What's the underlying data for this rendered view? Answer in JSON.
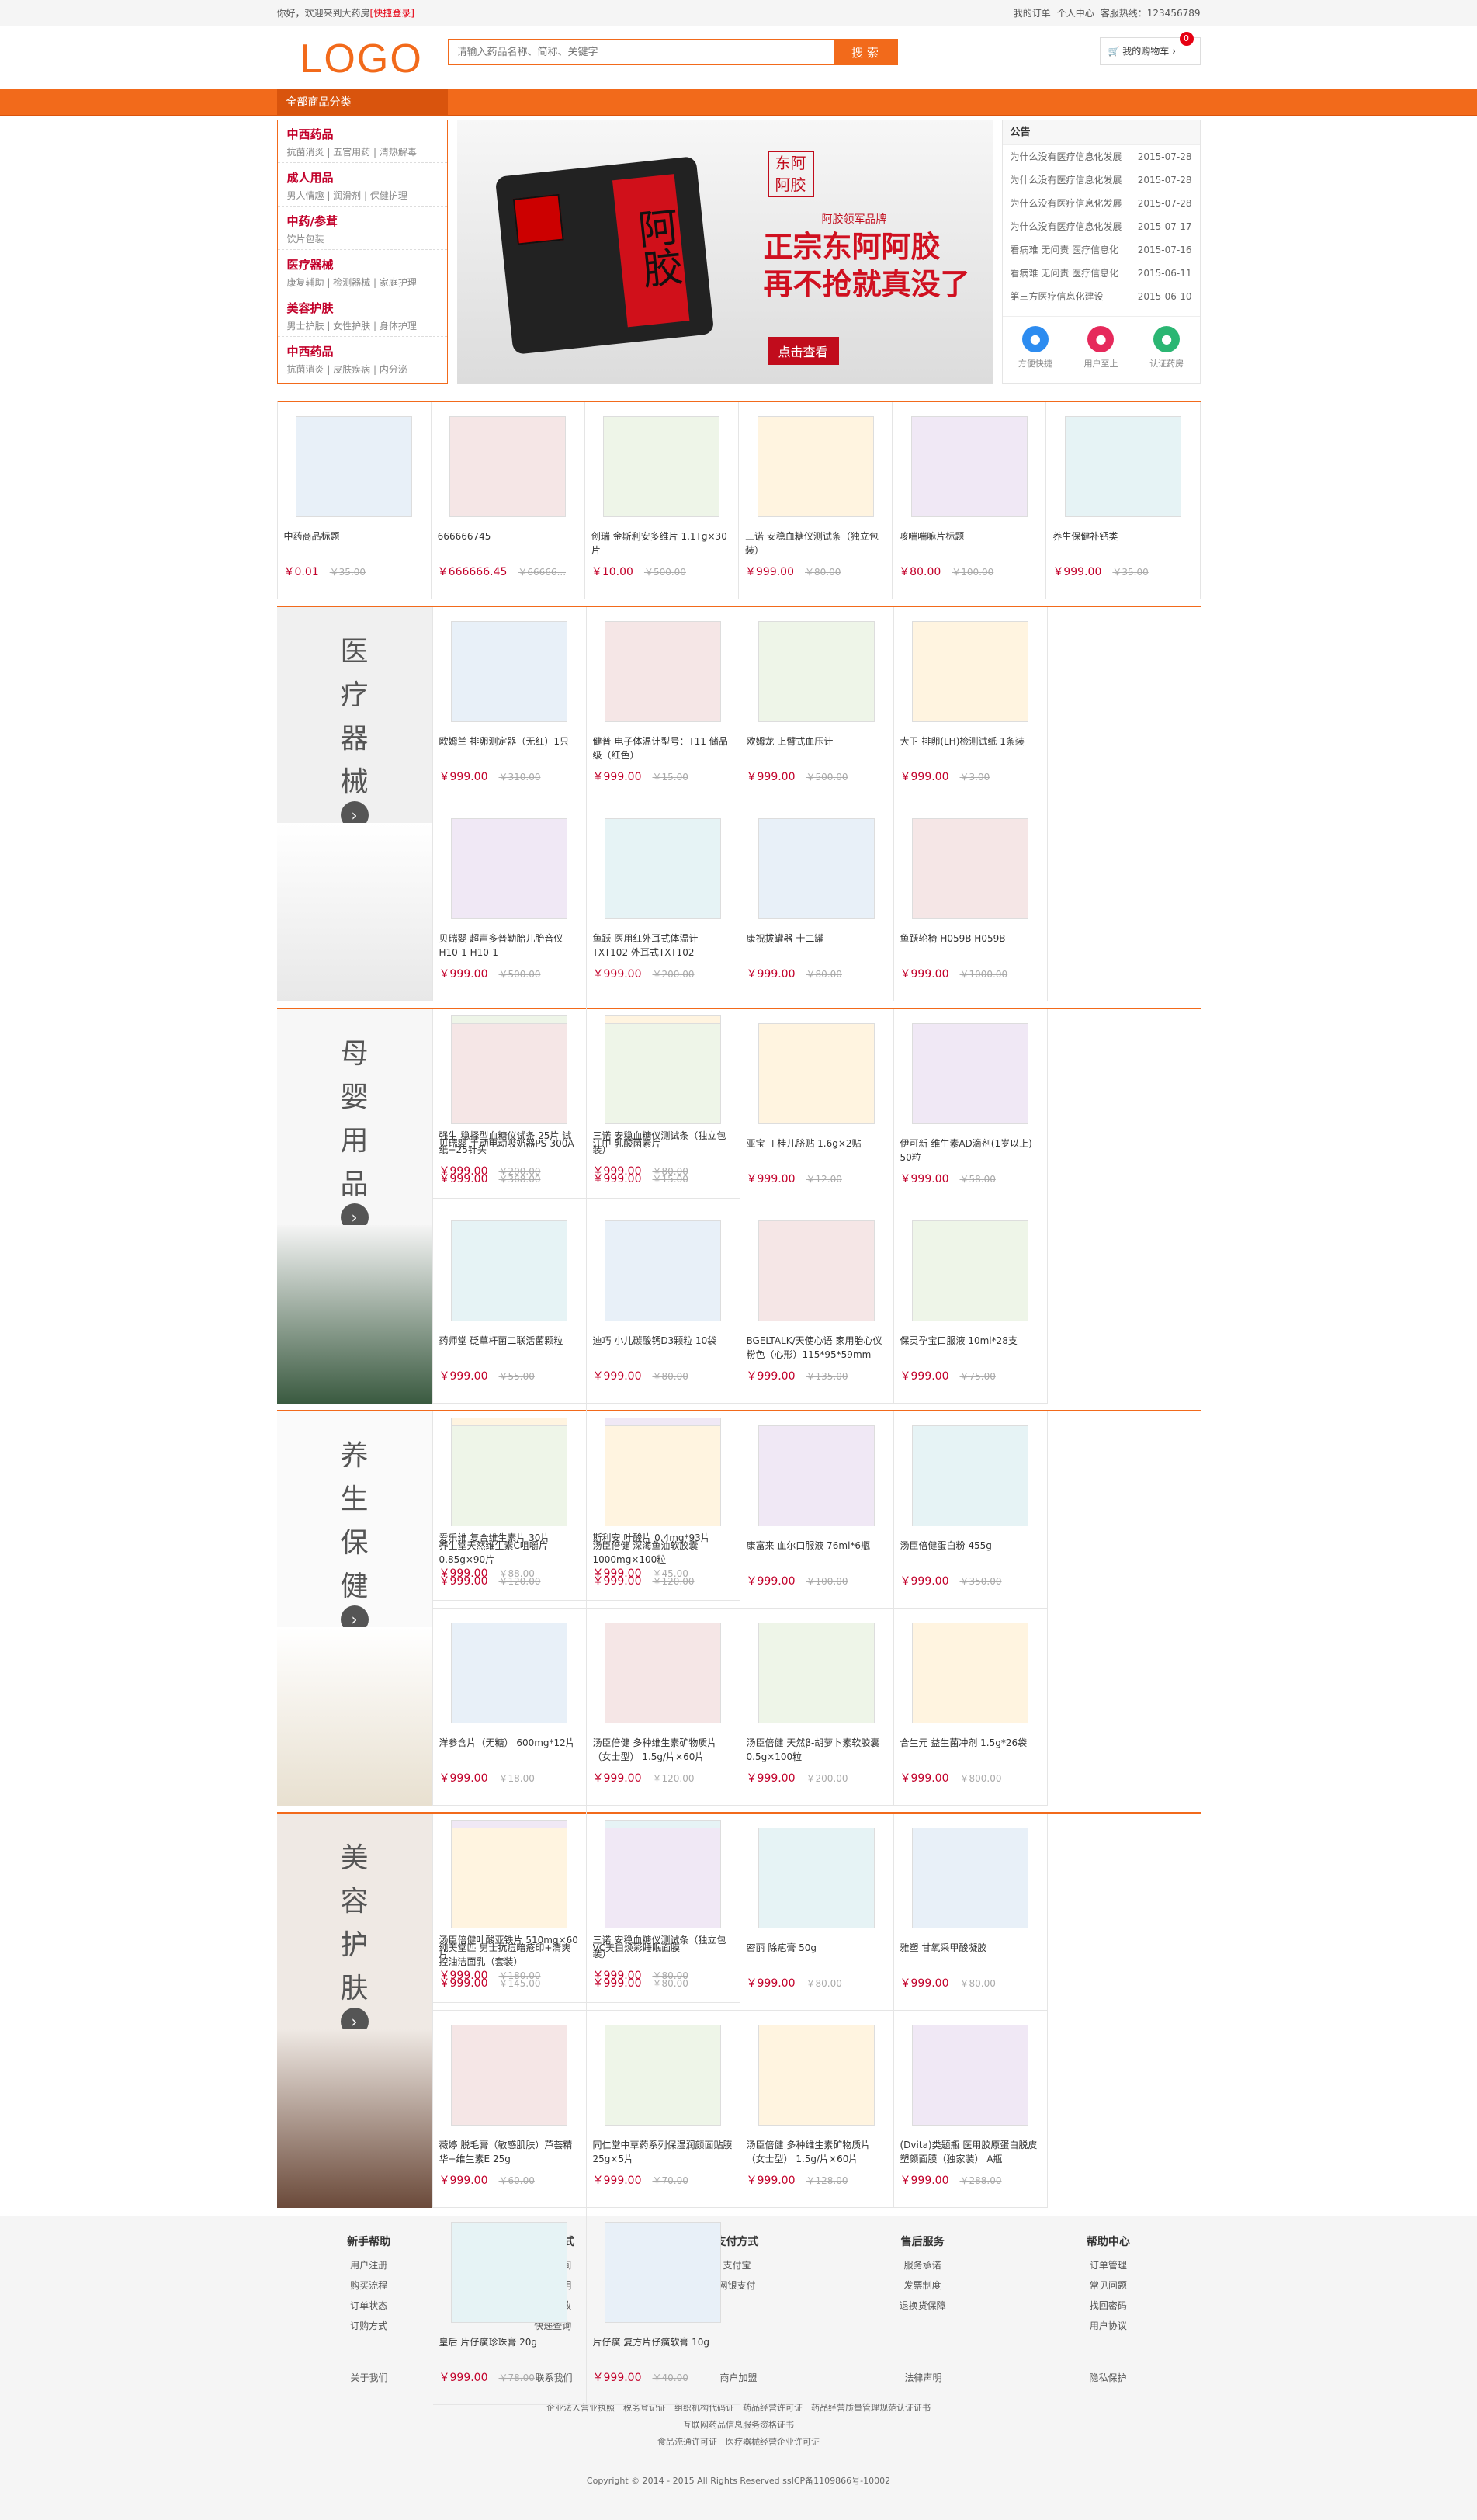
{
  "top": {
    "welcome": "你好，欢迎来到大药房",
    "login": "[快捷登录]",
    "orders": "我的订单",
    "ucenter": "个人中心",
    "hotline": "客服热线：123456789"
  },
  "header": {
    "logo": "LOGO",
    "search_placeholder": "请输入药品名称、简称、关键字",
    "search_btn": "搜 索",
    "cart": "我的购物车",
    "cart_count": "0"
  },
  "nav": {
    "allcat": "全部商品分类"
  },
  "cats": [
    {
      "t": "中西药品",
      "s": "抗菌消炎 | 五官用药 | 清热解毒"
    },
    {
      "t": "成人用品",
      "s": "男人情趣 | 润滑剂 | 保健护理"
    },
    {
      "t": "中药/参茸",
      "s": "饮片包装"
    },
    {
      "t": "医疗器械",
      "s": "康复辅助 | 检测器械 | 家庭护理"
    },
    {
      "t": "美容护肤",
      "s": "男士护肤 | 女性护肤 | 身体护理"
    },
    {
      "t": "中西药品",
      "s": "抗菌消炎 | 皮肤疾病 | 内分泌"
    }
  ],
  "slide": {
    "brand": "阿胶领军品牌",
    "h1a": "正宗东阿阿胶",
    "h1b": "再不抢就真没了",
    "btn": "点击查看",
    "box": "阿胶",
    "stamp": "东阿阿胶"
  },
  "notice": {
    "title": "公告",
    "items": [
      {
        "n": "为什么没有医疗信息化发展",
        "d": "2015-07-28"
      },
      {
        "n": "为什么没有医疗信息化发展",
        "d": "2015-07-28"
      },
      {
        "n": "为什么没有医疗信息化发展",
        "d": "2015-07-28"
      },
      {
        "n": "为什么没有医疗信息化发展",
        "d": "2015-07-17"
      },
      {
        "n": "看病难 无问责 医疗信息化",
        "d": "2015-07-16"
      },
      {
        "n": "看病难 无问责 医疗信息化",
        "d": "2015-06-11"
      },
      {
        "n": "第三方医疗信息化建设",
        "d": "2015-06-10"
      }
    ],
    "svc": [
      {
        "l": "方便快捷",
        "c": "#2d8cf0"
      },
      {
        "l": "用户至上",
        "c": "#e6295b"
      },
      {
        "l": "认证药房",
        "c": "#2bb673"
      }
    ]
  },
  "row1": [
    {
      "n": "中药商品标题",
      "p": "￥0.01",
      "o": "￥35.00"
    },
    {
      "n": "666666745",
      "p": "￥666666.45",
      "o": "￥66666..."
    },
    {
      "n": "创瑞 金斯利安多维片 1.1Tg×30片",
      "p": "￥10.00",
      "o": "￥500.00"
    },
    {
      "n": "三诺 安稳血糖仪测试条（独立包装）",
      "p": "￥999.00",
      "o": "￥80.00"
    },
    {
      "n": "咳喘喘嘛片标题",
      "p": "￥80.00",
      "o": "￥100.00"
    },
    {
      "n": "养生保健补钙类",
      "p": "￥999.00",
      "o": "￥35.00"
    }
  ],
  "floors": [
    {
      "title": [
        "医",
        "疗",
        "器",
        "械"
      ],
      "items": [
        {
          "n": "欧姆兰 排卵测定器（无红）1只",
          "p": "￥999.00",
          "o": "￥310.00"
        },
        {
          "n": "健普 电子体温计型号：T11 储品级（红色）",
          "p": "￥999.00",
          "o": "￥15.00"
        },
        {
          "n": "欧姆龙 上臂式血压计",
          "p": "￥999.00",
          "o": "￥500.00"
        },
        {
          "n": "大卫 排卵(LH)检测试纸 1条装",
          "p": "￥999.00",
          "o": "￥3.00"
        },
        {
          "n": "贝瑞婴 超声多普勒胎儿胎音仪 H10-1 H10-1",
          "p": "￥999.00",
          "o": "￥500.00"
        },
        {
          "n": "鱼跃 医用红外耳式体温计 TXT102 外耳式TXT102",
          "p": "￥999.00",
          "o": "￥200.00"
        },
        {
          "n": "康祝拔罐器 十二罐",
          "p": "￥999.00",
          "o": "￥80.00"
        },
        {
          "n": "鱼跃轮椅 H059B H059B",
          "p": "￥999.00",
          "o": "￥1000.00"
        },
        {
          "n": "强生 稳择型血糖仪试条 25片 试纸+25针头",
          "p": "￥999.00",
          "o": "￥200.00"
        },
        {
          "n": "三诺 安稳血糖仪测试条（独立包装）",
          "p": "￥999.00",
          "o": "￥80.00"
        }
      ]
    },
    {
      "title": [
        "母",
        "婴",
        "用",
        "品"
      ],
      "items": [
        {
          "n": "贝瑞婴 手动电动吸奶器PS-300A",
          "p": "￥999.00",
          "o": "￥368.00"
        },
        {
          "n": "江中 乳酸菌素片",
          "p": "￥999.00",
          "o": "￥15.00"
        },
        {
          "n": "亚宝 丁桂儿脐贴 1.6g×2贴",
          "p": "￥999.00",
          "o": "￥12.00"
        },
        {
          "n": "伊可新 维生素AD滴剂(1岁以上) 50粒",
          "p": "￥999.00",
          "o": "￥58.00"
        },
        {
          "n": "药师堂 砭草杆菌二联活菌颗粒",
          "p": "￥999.00",
          "o": "￥55.00"
        },
        {
          "n": "迪巧 小儿碳酸钙D3颗粒 10袋",
          "p": "￥999.00",
          "o": "￥80.00"
        },
        {
          "n": "BGELTALK/天使心语 家用胎心仪 粉色（心形）115*95*59mm",
          "p": "￥999.00",
          "o": "￥135.00"
        },
        {
          "n": "保灵孕宝口服液 10ml*28支",
          "p": "￥999.00",
          "o": "￥75.00"
        },
        {
          "n": "爱乐维 复合维生素片 30片",
          "p": "￥999.00",
          "o": "￥88.00"
        },
        {
          "n": "斯利安 叶酸片 0.4mg*93片",
          "p": "￥999.00",
          "o": "￥45.00"
        }
      ]
    },
    {
      "title": [
        "养",
        "生",
        "保",
        "健"
      ],
      "items": [
        {
          "n": "养生堂天然维生素C咀嚼片 0.85g×90片",
          "p": "￥999.00",
          "o": "￥120.00"
        },
        {
          "n": "汤臣倍健 深海鱼油软胶囊 1000mg×100粒",
          "p": "￥999.00",
          "o": "￥120.00"
        },
        {
          "n": "康富来 血尔口服液 76ml*6瓶",
          "p": "￥999.00",
          "o": "￥100.00"
        },
        {
          "n": "汤臣倍健蛋白粉 455g",
          "p": "￥999.00",
          "o": "￥350.00"
        },
        {
          "n": "洋参含片（无糖） 600mg*12片",
          "p": "￥999.00",
          "o": "￥18.00"
        },
        {
          "n": "汤臣倍健 多种维生素矿物质片（女士型） 1.5g/片×60片",
          "p": "￥999.00",
          "o": "￥120.00"
        },
        {
          "n": "汤臣倍健 天然β-胡萝卜素软胶囊 0.5g×100粒",
          "p": "￥999.00",
          "o": "￥200.00"
        },
        {
          "n": "合生元 益生菌冲剂 1.5g*26袋",
          "p": "￥999.00",
          "o": "￥800.00"
        },
        {
          "n": "汤臣倍健叶酸亚铁片 510mg×60片",
          "p": "￥999.00",
          "o": "￥180.00"
        },
        {
          "n": "三诺 安稳血糖仪测试条（独立包装）",
          "p": "￥999.00",
          "o": "￥80.00"
        }
      ]
    },
    {
      "title": [
        "美",
        "容",
        "护",
        "肤"
      ],
      "items": [
        {
          "n": "纯美堂匹 男士抗痘暗疮印+清爽控油洁面乳（套装）",
          "p": "￥999.00",
          "o": "￥145.00"
        },
        {
          "n": "VC美白焕彩睡眠面膜",
          "p": "￥999.00",
          "o": "￥80.00"
        },
        {
          "n": "密丽 除疤膏 50g",
          "p": "￥999.00",
          "o": "￥80.00"
        },
        {
          "n": "雅塑 甘氧采甲酸凝胶",
          "p": "￥999.00",
          "o": "￥80.00"
        },
        {
          "n": "薇婷 脱毛膏（敏感肌肤）芦荟精华+维生素E 25g",
          "p": "￥999.00",
          "o": "￥60.00"
        },
        {
          "n": "同仁堂中草药系列保湿润颜面贴膜 25g×5片",
          "p": "￥999.00",
          "o": "￥70.00"
        },
        {
          "n": "汤臣倍健 多种维生素矿物质片（女士型） 1.5g/片×60片",
          "p": "￥999.00",
          "o": "￥128.00"
        },
        {
          "n": "(Dvita)类题瓶 医用胶原蛋白脱皮塑颜面膜（独家装） A瓶",
          "p": "￥999.00",
          "o": "￥288.00"
        },
        {
          "n": "皇后 片仔癀珍珠膏 20g",
          "p": "￥999.00",
          "o": "￥78.00"
        },
        {
          "n": "片仔癀 复方片仔癀软膏 10g",
          "p": "￥999.00",
          "o": "￥40.00"
        }
      ]
    }
  ],
  "footer": {
    "cols": [
      {
        "h": "新手帮助",
        "i": [
          "用户注册",
          "购买流程",
          "订单状态",
          "订购方式"
        ]
      },
      {
        "h": "配送方式",
        "i": [
          "送货时间",
          "运费说明",
          "商品签收",
          "快递查询"
        ]
      },
      {
        "h": "支付方式",
        "i": [
          "支付宝",
          "网银支付"
        ]
      },
      {
        "h": "售后服务",
        "i": [
          "服务承诺",
          "发票制度",
          "退换货保障"
        ]
      },
      {
        "h": "帮助中心",
        "i": [
          "订单管理",
          "常见问题",
          "找回密码",
          "用户协议"
        ]
      }
    ],
    "links": [
      "关于我们",
      "联系我们",
      "商户加盟",
      "法律声明",
      "隐私保护"
    ],
    "lic1": "企业法人营业执照　税务登记证　组织机构代码证　药品经营许可证　药品经营质量管理规范认证证书",
    "lic2": "互联网药品信息服务资格证书",
    "lic3": "食品流通许可证　医疗器械经营企业许可证",
    "copy": "Copyright © 2014 - 2015 All Rights Reserved ssICP备1109866号-10002"
  }
}
